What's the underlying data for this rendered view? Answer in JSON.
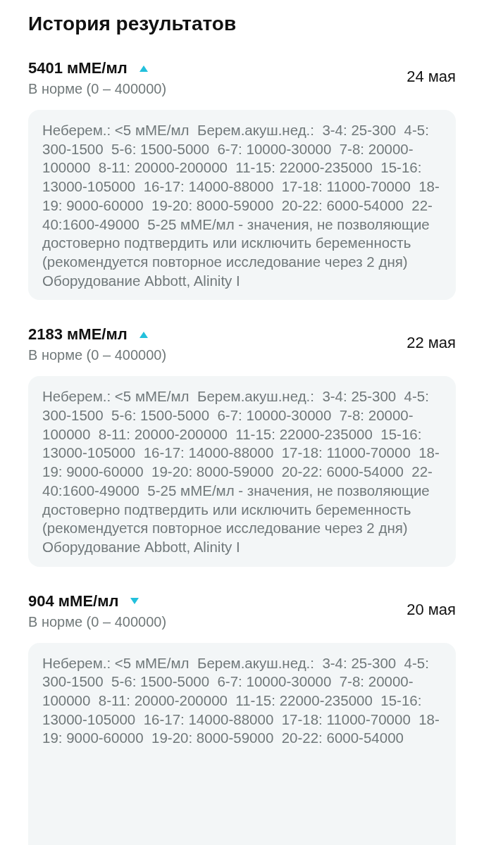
{
  "title": "История результатов",
  "results": [
    {
      "value": "5401 мМЕ/мл",
      "kind": "up",
      "norm": "В норме (0 – 400000)",
      "date": "24 мая",
      "note": "Неберем.: <5 мМЕ/мл  Берем.акуш.нед.:  3-4: 25-300  4-5: 300-1500  5-6: 1500-5000  6-7: 10000-30000  7-8: 20000-100000  8-11: 20000-200000  11-15: 22000-235000  15-16: 13000-105000  16-17: 14000-88000  17-18: 11000-70000  18-19: 9000-60000  19-20: 8000-59000  20-22: 6000-54000  22-40:1600-49000  5-25 мМЕ/мл - значения, не позволяющие достоверно подтвердить или исключить беременность (рекомендуется повторное исследование через 2 дня) Оборудование Abbott, Alinity I"
    },
    {
      "value": "2183 мМЕ/мл",
      "kind": "up",
      "norm": "В норме (0 – 400000)",
      "date": "22 мая",
      "note": "Неберем.: <5 мМЕ/мл  Берем.акуш.нед.:  3-4: 25-300  4-5: 300-1500  5-6: 1500-5000  6-7: 10000-30000  7-8: 20000-100000  8-11: 20000-200000  11-15: 22000-235000  15-16: 13000-105000  16-17: 14000-88000  17-18: 11000-70000  18-19: 9000-60000  19-20: 8000-59000  20-22: 6000-54000  22-40:1600-49000  5-25 мМЕ/мл - значения, не позволяющие достоверно подтвердить или исключить беременность (рекомендуется повторное исследование через 2 дня) Оборудование Abbott, Alinity I"
    },
    {
      "value": "904 мМЕ/мл",
      "kind": "down",
      "norm": "В норме (0 – 400000)",
      "date": "20 мая",
      "note": "Неберем.: <5 мМЕ/мл  Берем.акуш.нед.:  3-4: 25-300  4-5: 300-1500  5-6: 1500-5000  6-7: 10000-30000  7-8: 20000-100000  8-11: 20000-200000  11-15: 22000-235000  15-16: 13000-105000  16-17: 14000-88000  17-18: 11000-70000  18-19: 9000-60000  19-20: 8000-59000  20-22: 6000-54000"
    }
  ]
}
